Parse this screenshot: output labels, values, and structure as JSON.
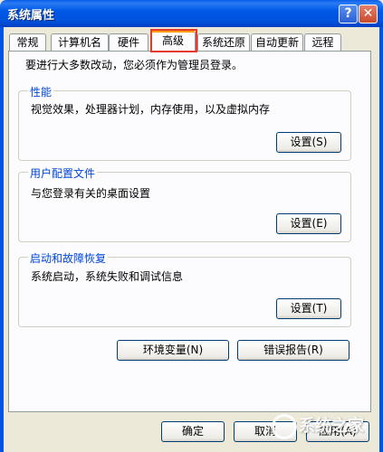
{
  "window": {
    "title": "系统属性",
    "help": "?",
    "close": "✕"
  },
  "tabs": [
    {
      "label": "常规"
    },
    {
      "label": "计算机名"
    },
    {
      "label": "硬件"
    },
    {
      "label": "高级"
    },
    {
      "label": "系统还原"
    },
    {
      "label": "自动更新"
    },
    {
      "label": "远程"
    }
  ],
  "active_tab": "高级",
  "intro": "要进行大多数改动，您必须作为管理员登录。",
  "groups": {
    "performance": {
      "title": "性能",
      "desc": "视觉效果，处理器计划，内存使用，以及虚拟内存",
      "button": "设置(S)"
    },
    "user_profiles": {
      "title": "用户配置文件",
      "desc": "与您登录有关的桌面设置",
      "button": "设置(E)"
    },
    "startup": {
      "title": "启动和故障恢复",
      "desc": "系统启动，系统失败和调试信息",
      "button": "设置(T)"
    }
  },
  "buttons": {
    "env": "环境变量(N)",
    "error": "错误报告(R)",
    "ok": "确定",
    "cancel": "取消",
    "apply": "应用(A)"
  },
  "watermark": "系统之家",
  "colors": {
    "titlebar": "#0054e3",
    "group_title": "#0046d5",
    "highlight": "#e53b2d",
    "tab_accent": "#ff9c00"
  }
}
